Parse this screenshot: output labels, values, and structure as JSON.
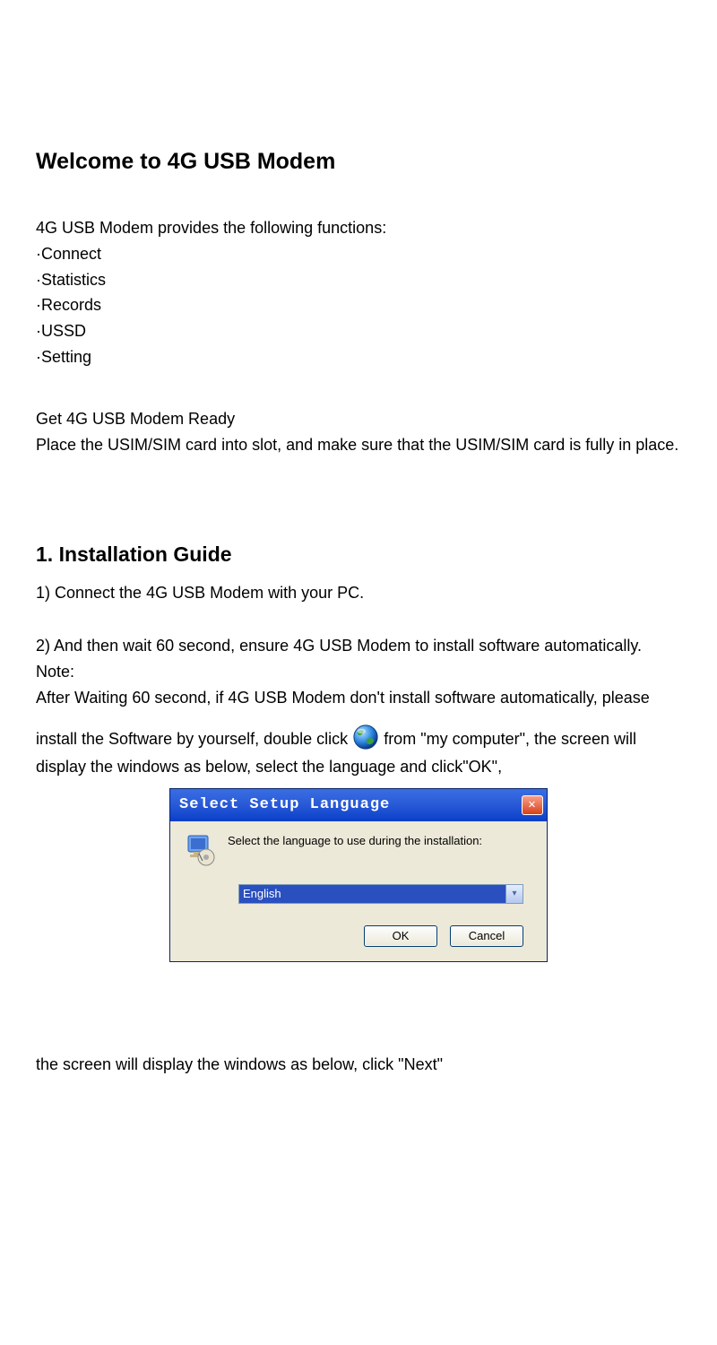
{
  "title": "Welcome to 4G USB Modem",
  "intro": "4G USB Modem provides the following functions:",
  "functions": [
    "·Connect",
    "·Statistics",
    "·Records",
    "·USSD",
    "·Setting"
  ],
  "ready_heading": "Get 4G USB Modem Ready",
  "ready_text": "Place the USIM/SIM card into slot, and make sure that the USIM/SIM card is fully in place.",
  "install_heading": "1. Installation Guide",
  "step1": "1) Connect the 4G USB Modem with your PC.",
  "step2": "2) And then wait 60 second, ensure 4G USB Modem to install software automatically.",
  "note_label": "Note:",
  "note_text_a": "After Waiting 60 second, if 4G USB Modem don't install software automatically, please",
  "note_text_b_pre": "install the Software by yourself, double click ",
  "note_text_b_post": " from \"my computer\", the screen will display the windows as below,   select the language and click\"OK\",",
  "dialog": {
    "title": "Select Setup Language",
    "prompt": "Select the language to use during the installation:",
    "selected": "English",
    "ok": "OK",
    "cancel": "Cancel"
  },
  "after_dialog": "the screen will display the windows as below, click \"Next\""
}
